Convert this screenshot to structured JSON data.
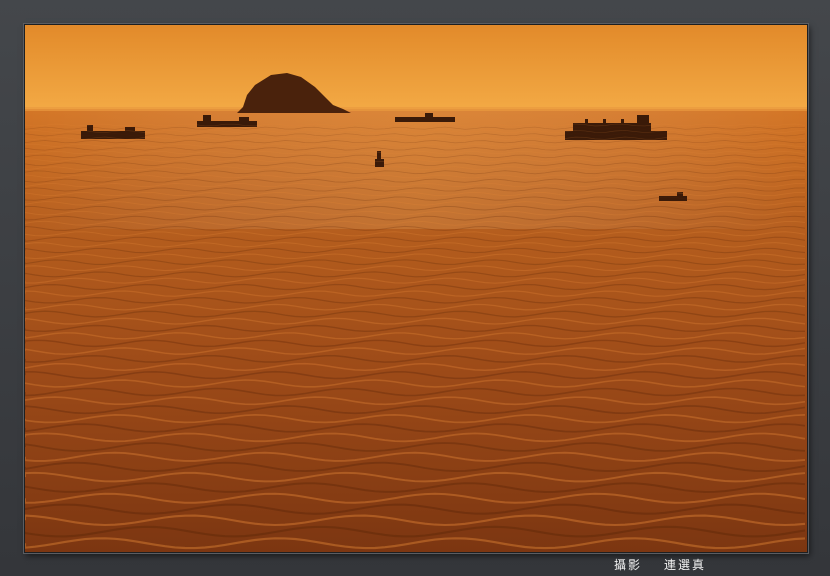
{
  "photo": {
    "subject": "sunset-sea-scene",
    "colors": {
      "sky_top": "#e7922f",
      "sky_horizon": "#f0a43c",
      "sea_near_horizon": "#c96a1e",
      "sea_mid": "#a5501a",
      "sea_bottom": "#7a3510",
      "silhouette": "#2a1408"
    }
  },
  "caption": {
    "label": "攝影",
    "author": "連選真"
  }
}
